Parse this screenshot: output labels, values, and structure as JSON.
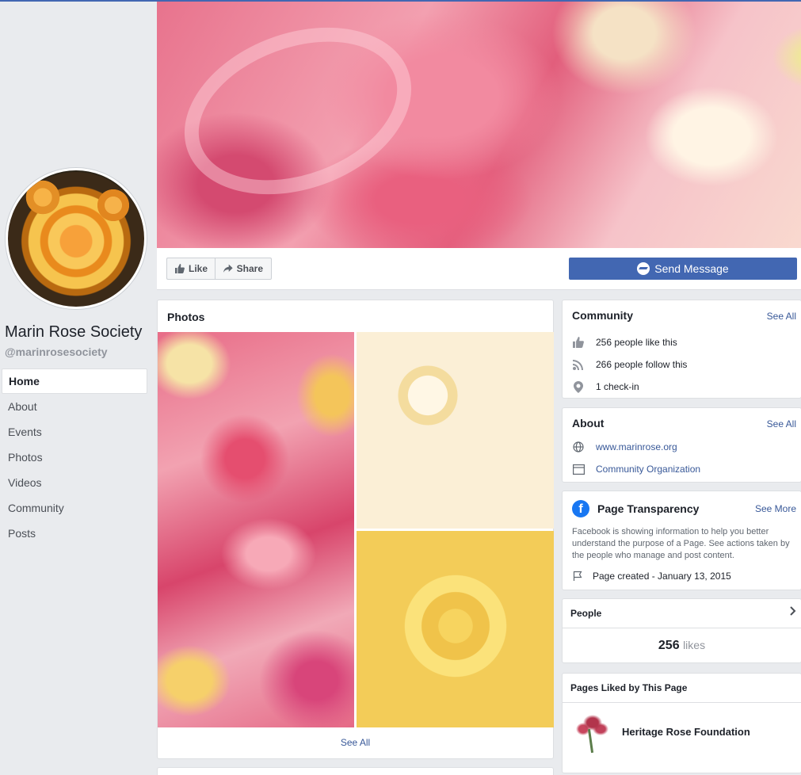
{
  "sidebar": {
    "page_name": "Marin Rose Society",
    "page_handle": "@marinrosesociety",
    "nav": [
      "Home",
      "About",
      "Events",
      "Photos",
      "Videos",
      "Community",
      "Posts"
    ],
    "active": "Home"
  },
  "actions": {
    "like_label": "Like",
    "share_label": "Share",
    "send_message_label": "Send Message"
  },
  "photos": {
    "title": "Photos",
    "see_all": "See All"
  },
  "community": {
    "title": "Community",
    "see_all": "See All",
    "likes_text": "256 people like this",
    "follows_text": "266 people follow this",
    "checkins_text": "1 check-in"
  },
  "about": {
    "title": "About",
    "see_all": "See All",
    "website": "www.marinrose.org",
    "category": "Community Organization"
  },
  "transparency": {
    "title": "Page Transparency",
    "see_more": "See More",
    "description": "Facebook is showing information to help you better understand the purpose of a Page. See actions taken by the people who manage and post content.",
    "created": "Page created - January 13, 2015"
  },
  "people": {
    "title": "People",
    "likes_count": "256",
    "likes_label": "likes"
  },
  "pages_liked": {
    "title": "Pages Liked by This Page",
    "items": [
      "Heritage Rose Foundation"
    ]
  },
  "colors": {
    "brand_blue": "#4267b2",
    "link": "#385898",
    "background": "#e9ebee"
  }
}
